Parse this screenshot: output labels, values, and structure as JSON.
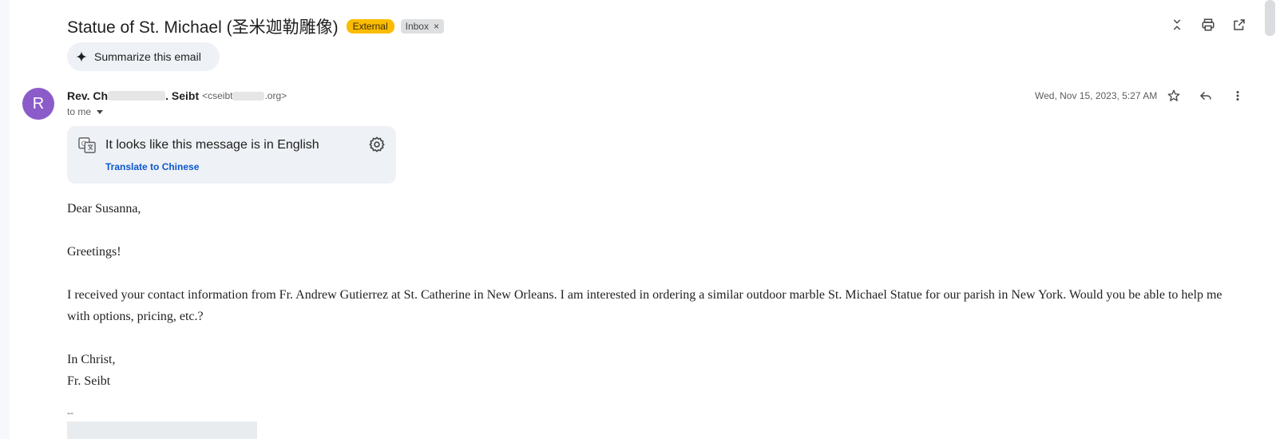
{
  "email": {
    "subject": "Statue of St. Michael (圣米迦勒雕像)",
    "labels": {
      "external": "External",
      "inbox": "Inbox",
      "remove": "×"
    },
    "summarize_label": "Summarize this email",
    "sender": {
      "avatar_letter": "R",
      "name_start": "Rev. Ch",
      "name_end": ". Seibt",
      "email_start": "<cseibt",
      "email_end": ".org>",
      "avatar_color": "#8b5cc9"
    },
    "recipient_label": "to me",
    "date": "Wed, Nov 15, 2023, 5:27 AM"
  },
  "translate": {
    "message": "It looks like this message is in English",
    "link": "Translate to Chinese"
  },
  "body": {
    "greeting": "Dear Susanna,",
    "line1": "Greetings!",
    "paragraph": "I received your contact information from Fr. Andrew Gutierrez at St. Catherine in New Orleans. I am interested in ordering a similar outdoor marble St. Michael Statue for our parish in New York. Would you be able to help me with options, pricing, etc.?",
    "closing": "In Christ,",
    "signature": "Fr. Seibt",
    "sig_separator": "--"
  },
  "icons": {
    "top": [
      "collapse-all-icon",
      "print-icon",
      "open-in-new-window-icon"
    ],
    "message": [
      "star-icon",
      "reply-icon",
      "more-vert-icon"
    ],
    "other": [
      "sparkle-icon",
      "translate-icon",
      "gear-icon",
      "caret-down-icon"
    ]
  },
  "colors": {
    "external_badge": "#fbbc04",
    "link": "#0b57d0"
  }
}
